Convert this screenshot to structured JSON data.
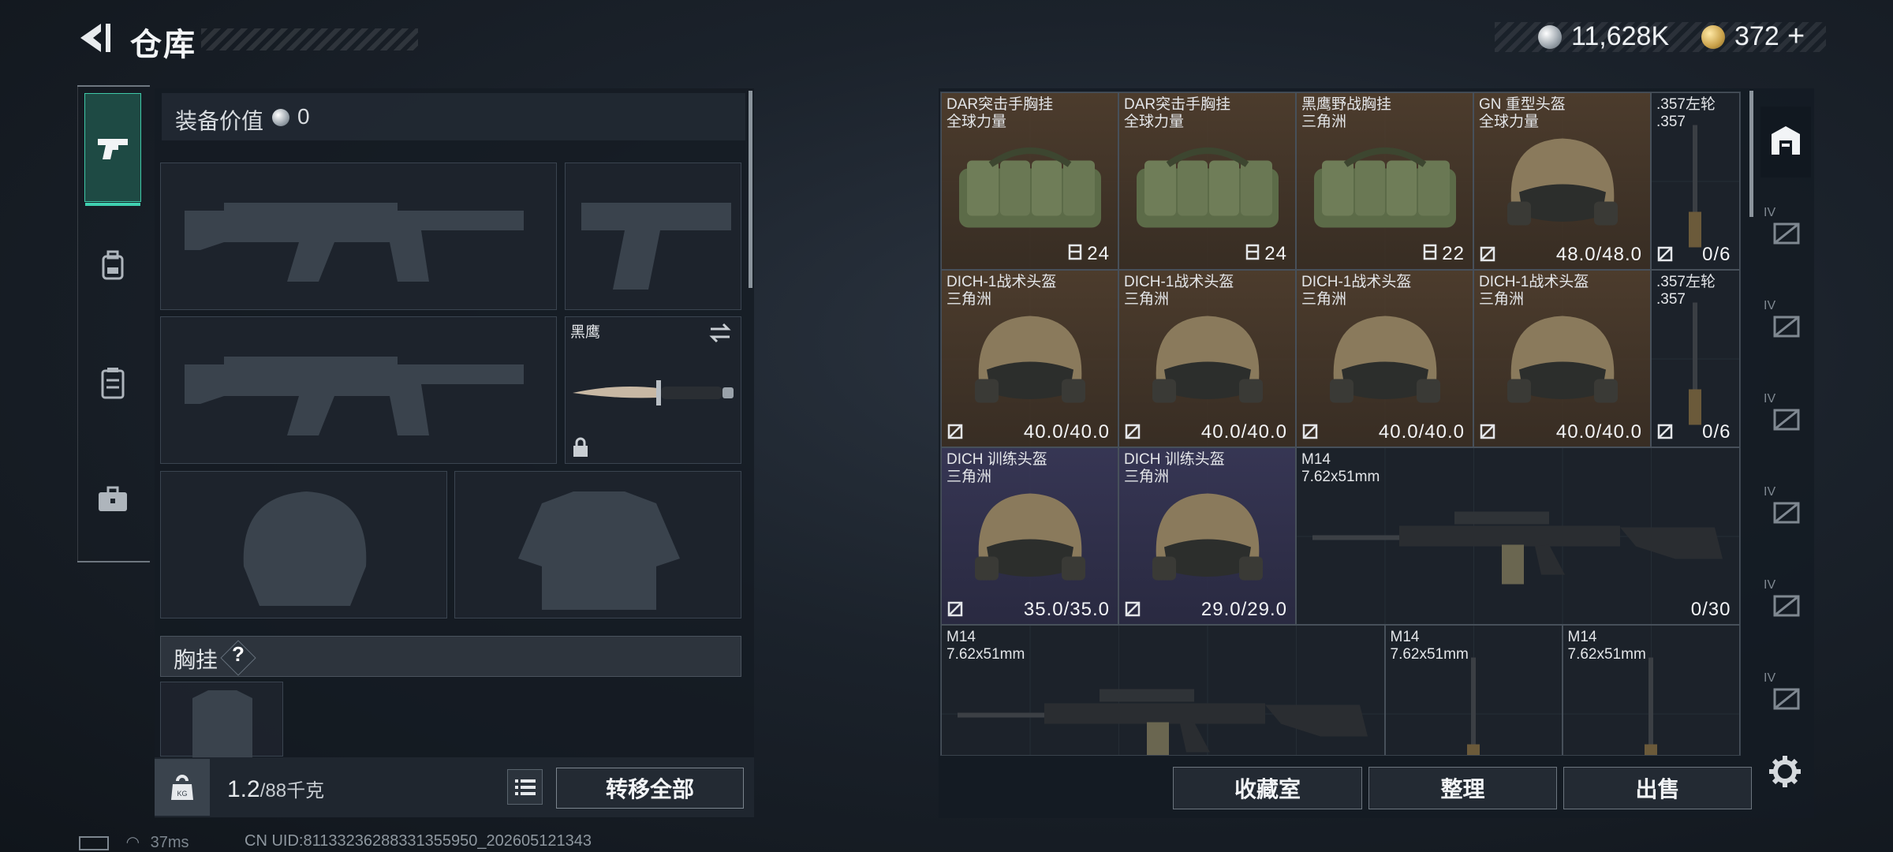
{
  "header": {
    "title": "仓库"
  },
  "currency": {
    "silver": {
      "amount": "11,628K",
      "icon": "silver-coin-icon"
    },
    "gold": {
      "amount": "372",
      "plus": "+",
      "icon": "gold-coin-icon"
    }
  },
  "left_tabs": [
    {
      "name": "weapons",
      "icon": "pistol-icon",
      "active": true
    },
    {
      "name": "backpack",
      "icon": "backpack-icon",
      "active": false
    },
    {
      "name": "chest-rig",
      "icon": "vest-icon",
      "active": false
    },
    {
      "name": "toolbox",
      "icon": "briefcase-icon",
      "active": false
    }
  ],
  "equipment": {
    "value_label": "装备价值",
    "value": "0",
    "melee": {
      "name": "黑鹰"
    },
    "chest_rig_label": "胸挂",
    "chest_help": "?"
  },
  "capacity": {
    "weight": "1.2",
    "max": "/88千克",
    "transfer_all": "转移全部"
  },
  "items": [
    {
      "name": "DAR突击手胸挂",
      "sub": "全球力量",
      "stat": "24",
      "kind": "rig",
      "rarity": "brown"
    },
    {
      "name": "DAR突击手胸挂",
      "sub": "全球力量",
      "stat": "24",
      "kind": "rig",
      "rarity": "brown"
    },
    {
      "name": "黑鹰野战胸挂",
      "sub": "三角洲",
      "stat": "22",
      "kind": "rig",
      "rarity": "brown"
    },
    {
      "name": "GN 重型头盔",
      "sub": "全球力量",
      "stat": "48.0/48.0",
      "kind": "helmet",
      "rarity": "brown"
    },
    {
      "name": ".357左轮",
      "sub": ".357",
      "stat": "0/6",
      "kind": "ammo",
      "rarity": "dark"
    },
    {
      "name": "DICH-1战术头盔",
      "sub": "三角洲",
      "stat": "40.0/40.0",
      "kind": "helmet",
      "rarity": "brown"
    },
    {
      "name": "DICH-1战术头盔",
      "sub": "三角洲",
      "stat": "40.0/40.0",
      "kind": "helmet",
      "rarity": "brown"
    },
    {
      "name": "DICH-1战术头盔",
      "sub": "三角洲",
      "stat": "40.0/40.0",
      "kind": "helmet",
      "rarity": "brown"
    },
    {
      "name": "DICH-1战术头盔",
      "sub": "三角洲",
      "stat": "40.0/40.0",
      "kind": "helmet",
      "rarity": "brown"
    },
    {
      "name": ".357左轮",
      "sub": ".357",
      "stat": "0/6",
      "kind": "ammo",
      "rarity": "dark"
    },
    {
      "name": "DICH 训练头盔",
      "sub": "三角洲",
      "stat": "35.0/35.0",
      "kind": "helmet",
      "rarity": "purple"
    },
    {
      "name": "DICH 训练头盔",
      "sub": "三角洲",
      "stat": "29.0/29.0",
      "kind": "helmet",
      "rarity": "purple"
    },
    {
      "name": "M14",
      "sub": "7.62x51mm",
      "stat": "0/30",
      "kind": "rifle",
      "rarity": "dark"
    },
    {
      "name": "M14",
      "sub": "7.62x51mm",
      "stat": "",
      "kind": "rifle",
      "rarity": "dark"
    },
    {
      "name": "M14",
      "sub": "7.62x51mm",
      "stat": "",
      "kind": "ammo",
      "rarity": "dark"
    },
    {
      "name": "M14",
      "sub": "7.62x51mm",
      "stat": "",
      "kind": "ammo",
      "rarity": "dark"
    }
  ],
  "right_tabs": [
    {
      "name": "all",
      "icon": "storage-icon",
      "tier": ""
    },
    {
      "name": "weapons",
      "icon": "rifle-category-icon",
      "tier": "IV"
    },
    {
      "name": "armor",
      "icon": "armor-category-icon",
      "tier": "IV"
    },
    {
      "name": "helmet",
      "icon": "helmet-category-icon",
      "tier": "IV"
    },
    {
      "name": "medical",
      "icon": "medical-category-icon",
      "tier": "IV"
    },
    {
      "name": "ammo",
      "icon": "ammo-category-icon",
      "tier": "IV"
    },
    {
      "name": "misc",
      "icon": "misc-category-icon",
      "tier": "IV"
    }
  ],
  "actions": {
    "collection": "收藏室",
    "sort": "整理",
    "sell": "出售"
  },
  "status": {
    "ping": "37ms",
    "uid": "CN UID:8113323628833135595​0_202605121343"
  },
  "colors": {
    "accent": "#3fd0b0",
    "brown_rarity": "#4f3e2e",
    "purple_rarity": "#3a3956"
  }
}
